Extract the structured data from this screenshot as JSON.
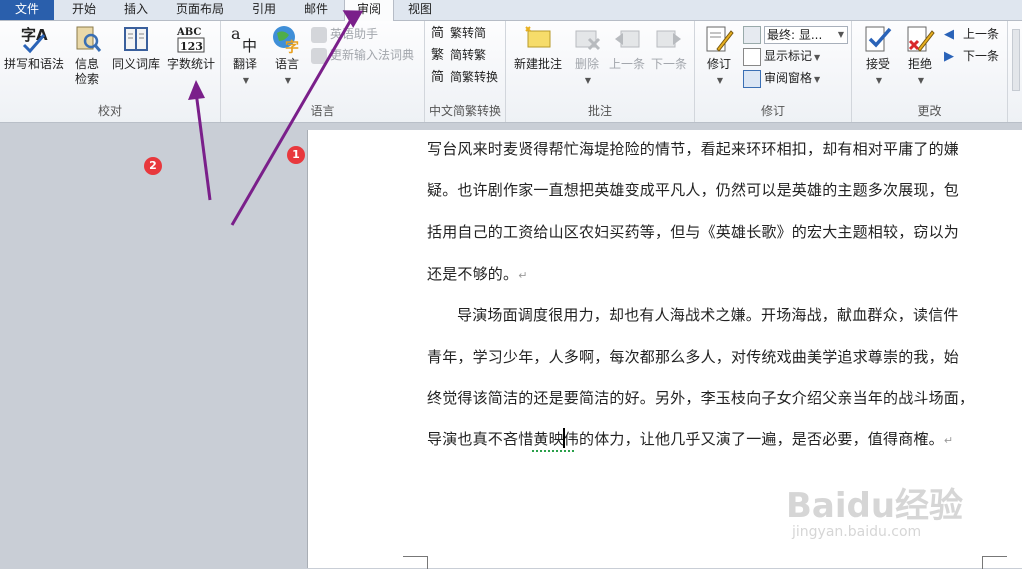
{
  "tabs": [
    {
      "label": "文件"
    },
    {
      "label": "开始"
    },
    {
      "label": "插入"
    },
    {
      "label": "页面布局"
    },
    {
      "label": "引用"
    },
    {
      "label": "邮件"
    },
    {
      "label": "审阅"
    },
    {
      "label": "视图"
    }
  ],
  "groups": {
    "proofing": {
      "label": "校对",
      "spelling": "拼写和语法",
      "research_line1": "信息",
      "research_line2": "检索",
      "thesaurus": "同义词库",
      "wordcount": "字数统计"
    },
    "language": {
      "label": "语言",
      "translate": "翻译",
      "language": "语言",
      "ime_assistant": "英语助手",
      "ime_dict": "更新输入法词典"
    },
    "chinese": {
      "label": "中文简繁转换",
      "to_simplified": "繁转简",
      "to_traditional": "简转繁",
      "convert": "简繁转换"
    },
    "comments": {
      "label": "批注",
      "new_comment": "新建批注",
      "delete": "删除",
      "previous": "上一条",
      "next": "下一条"
    },
    "tracking": {
      "label": "修订",
      "track_changes": "修订",
      "display_mode": "最终: 显...",
      "show_markup": "显示标记",
      "reviewing_pane": "审阅窗格"
    },
    "changes": {
      "label": "更改",
      "accept": "接受",
      "reject": "拒绝",
      "previous": "上一条",
      "next": "下一条"
    }
  },
  "document": {
    "lines": [
      "写台风来时麦贤得帮忙海堤抢险的情节，看起来环环相扣，却有相对平庸了的嫌",
      "疑。也许剧作家一直想把英雄变成平凡人，仍然可以是英雄的主题多次展现，包",
      "括用自己的工资给山区农妇买药等，但与《英雄长歌》的宏大主题相较，窃以为",
      "还是不够的。",
      "导演场面调度很用力，却也有人海战术之嫌。开场海战，献血群众，读信件",
      "青年，学习少年，人多啊，每次都那么多人，对传统戏曲美学追求尊崇的我，始",
      "终觉得该简洁的还是要简洁的好。另外，李玉枝向子女介绍父亲当年的战斗场面，",
      "导演也真不吝惜黄映伟的体力，让他几乎又演了一遍，是否必要，值得商榷。"
    ],
    "para_mark": "↵"
  },
  "annotations": {
    "badge1": "1",
    "badge2": "2",
    "arrow_color": "#7a1f8a"
  },
  "watermark": {
    "brand": "Baidu经验",
    "url": "jingyan.baidu.com"
  }
}
